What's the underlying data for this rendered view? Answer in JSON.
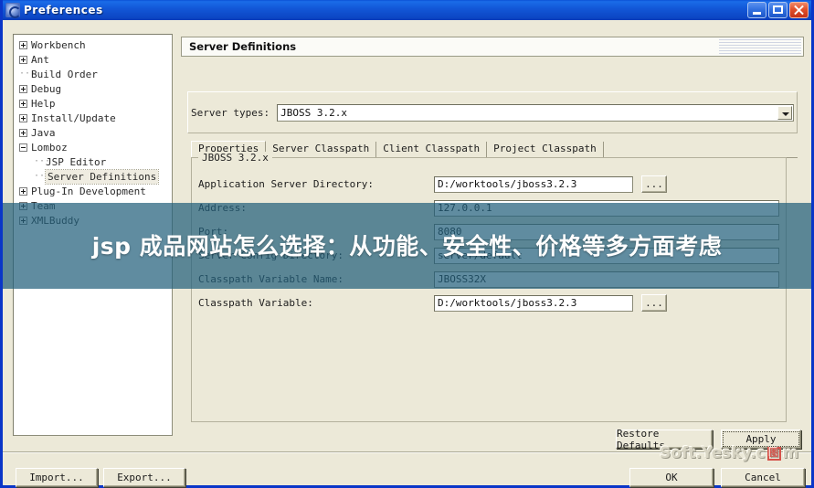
{
  "window": {
    "title": "Preferences",
    "icon": "eclipse-icon",
    "buttons": {
      "minimize": "minimize-icon",
      "maximize": "maximize-icon",
      "close": "close-icon"
    }
  },
  "tree": {
    "items": [
      {
        "label": "Workbench",
        "toggle": "plus",
        "level": 1,
        "selected": false
      },
      {
        "label": "Ant",
        "toggle": "plus",
        "level": 1,
        "selected": false
      },
      {
        "label": "Build Order",
        "toggle": "none",
        "level": 1,
        "selected": false
      },
      {
        "label": "Debug",
        "toggle": "plus",
        "level": 1,
        "selected": false
      },
      {
        "label": "Help",
        "toggle": "plus",
        "level": 1,
        "selected": false
      },
      {
        "label": "Install/Update",
        "toggle": "plus",
        "level": 1,
        "selected": false
      },
      {
        "label": "Java",
        "toggle": "plus",
        "level": 1,
        "selected": false
      },
      {
        "label": "Lomboz",
        "toggle": "minus",
        "level": 1,
        "selected": false
      },
      {
        "label": "JSP Editor",
        "toggle": "none",
        "level": 2,
        "selected": false
      },
      {
        "label": "Server Definitions",
        "toggle": "none",
        "level": 2,
        "selected": true
      },
      {
        "label": "Plug-In Development",
        "toggle": "plus",
        "level": 1,
        "selected": false
      },
      {
        "label": "Team",
        "toggle": "plus",
        "level": 1,
        "selected": false
      },
      {
        "label": "XMLBuddy",
        "toggle": "plus",
        "level": 1,
        "selected": false
      }
    ]
  },
  "pane": {
    "header_title": "Server Definitions",
    "server_types_label": "Server types:",
    "server_types_value": "JBOSS 3.2.x",
    "tabs": [
      {
        "label": "Properties",
        "active": true
      },
      {
        "label": "Server Classpath",
        "active": false
      },
      {
        "label": "Client Classpath",
        "active": false
      },
      {
        "label": "Project Classpath",
        "active": false
      }
    ],
    "group_legend": "JBOSS 3.2.x",
    "fields": [
      {
        "label": "Application Server Directory:",
        "value": "D:/worktools/jboss3.2.3",
        "browse": "...",
        "has_browse": true,
        "width": "short"
      },
      {
        "label": "Address:",
        "value": "127.0.0.1",
        "has_browse": false,
        "width": "long"
      },
      {
        "label": "Port:",
        "value": "8080",
        "has_browse": false,
        "width": "long"
      },
      {
        "label": "Server Config Directory:",
        "value": "server/default",
        "has_browse": false,
        "width": "long"
      },
      {
        "label": "Classpath Variable Name:",
        "value": "JBOSS32X",
        "has_browse": false,
        "width": "long"
      },
      {
        "label": "Classpath Variable:",
        "value": "D:/worktools/jboss3.2.3",
        "browse": "...",
        "has_browse": true,
        "width": "short"
      }
    ]
  },
  "buttons": {
    "restore_defaults": "Restore Defaults",
    "apply": "Apply",
    "import": "Import...",
    "export": "Export...",
    "ok": "OK",
    "cancel": "Cancel"
  },
  "overlay": {
    "text": "jsp 成品网站怎么选择：从功能、安全性、价格等多方面考虑",
    "band_color": "#235F7B"
  },
  "watermark": {
    "prefix": "Soft.Yesky.c",
    "badge": "图",
    "suffix": "m"
  },
  "colors": {
    "title_bar": "#1358D8",
    "dialog_face": "#ECE9D8",
    "field_bg": "#FFFFFF",
    "border": "#8A8A76",
    "close_button": "#E2512A"
  }
}
